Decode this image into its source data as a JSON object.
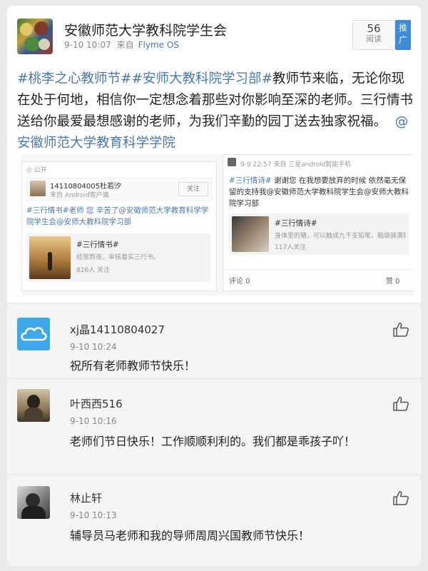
{
  "header": {
    "account_name": "安徽师范大学教科院学生会",
    "time": "9-10 10:07",
    "source_prefix": "来自",
    "source": "Flyme OS",
    "read_count": "56",
    "read_label": "阅读",
    "promo_label": "推广"
  },
  "post": {
    "tag1": "#桃李之心教师节#",
    "tag2": "#安师大教科院学习部#",
    "text": "教师节来临，无论你现在处于何地，相信你一定想念着那些对你影响至深的老师。三行情书送给你最爱最想感谢的老师，为我们辛勤的园丁送去独家祝福。",
    "mention": "@安徽师范大学教育科学学院"
  },
  "embed": {
    "left_card": {
      "public_label": "公开",
      "user_line": "14110804005杜若汐",
      "user_sub": "来自 Android客户端",
      "follow_label": "关注",
      "text": "#三行情书#老师 您 辛苦了@安徽师范大学教育科学学院学生会@安师大教科院学习部",
      "inner_title": "#三行情书#",
      "inner_text": "经常熬夜，审核着实三行书。",
      "inner_sub": "826人 关注"
    },
    "right_card": {
      "meta": "9-9 22:57 来自 三星android智能手机",
      "text_tag": "#三行情诗#",
      "text": "谢谢您 在我想要放弃的时候 依然毫无保留的支持我@安徽师范大学教科院学生会@安师大教科院学习部",
      "inner_title": "#三行情诗#",
      "inner_text": "身体里的猪，可以触成九千支铅笔，脑袋装满铅笔头...",
      "inner_sub": "117人关注",
      "comment_label": "评论 0",
      "like_label": "赞 0"
    }
  },
  "comments": [
    {
      "name": "xj晶14110804027",
      "time": "9-10 10:24",
      "text": "祝所有老师教师节快乐！",
      "avatar": "cloud-avatar"
    },
    {
      "name": "叶西西516",
      "time": "9-10 10:16",
      "text": "老师们节日快乐！工作顺顺利利的。我们都是乖孩子吖！",
      "avatar": "girl-avatar"
    },
    {
      "name": "林止轩",
      "time": "9-10 10:13",
      "text": "辅导员马老师和我的导师周周兴国教师节快乐！",
      "avatar": "man-avatar"
    }
  ],
  "colors": {
    "link_blue": "#4a78a8",
    "promo_blue": "#3e8ad4",
    "cloud_blue": "#3fa9e8"
  }
}
